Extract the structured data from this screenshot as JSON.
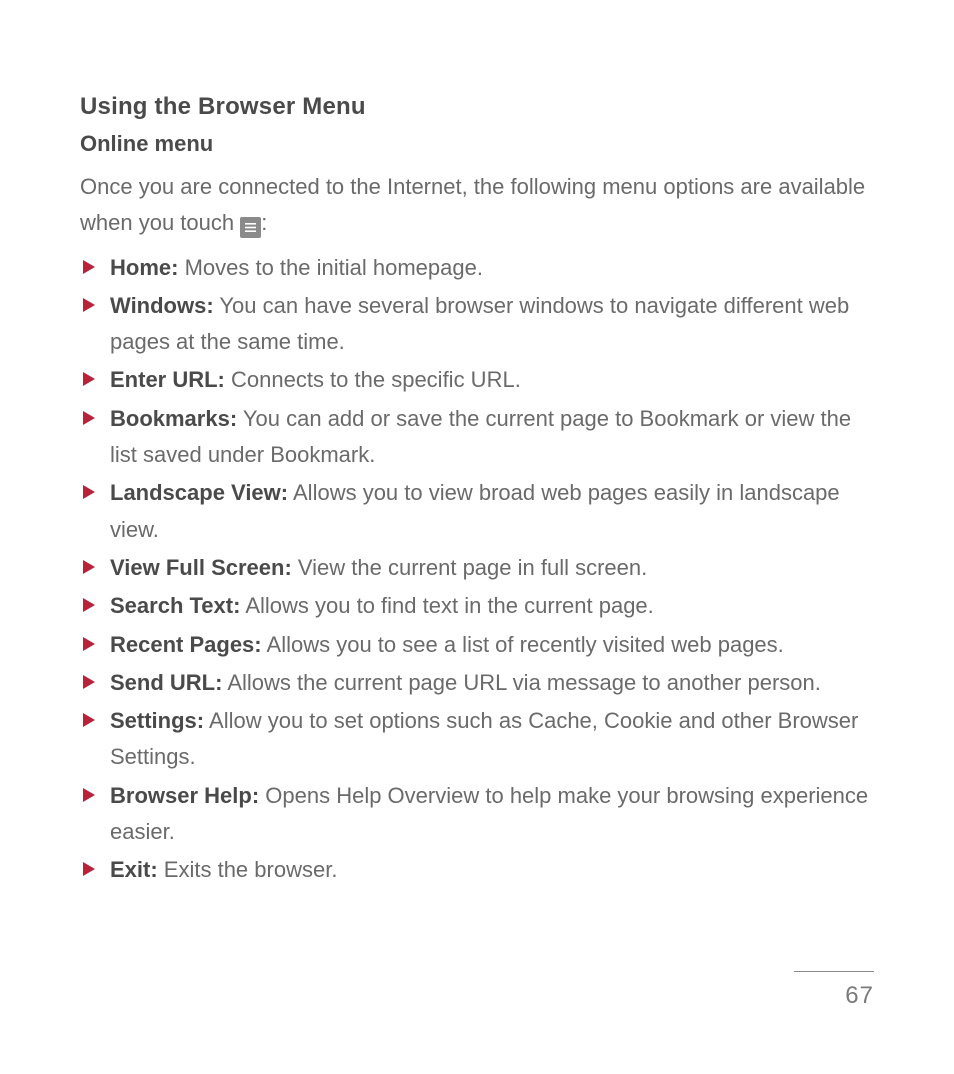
{
  "title": "Using the Browser Menu",
  "subtitle": "Online menu",
  "intro_a": "Once you are connected to the Internet, the following menu options are available when you touch ",
  "intro_b": ":",
  "items": [
    {
      "label": "Home:",
      "desc": " Moves to the initial homepage."
    },
    {
      "label": "Windows:",
      "desc": " You can have several browser windows to navigate different web pages at the same time."
    },
    {
      "label": "Enter URL:",
      "desc": " Connects to the specific URL."
    },
    {
      "label": "Bookmarks:",
      "desc": " You can add or save the current page to Bookmark or view the list saved under Bookmark."
    },
    {
      "label": "Landscape View:",
      "desc": " Allows you to view broad web pages easily in landscape view."
    },
    {
      "label": "View Full Screen:",
      "desc": " View the current page in full screen."
    },
    {
      "label": "Search Text:",
      "desc": " Allows you to find text in the current page."
    },
    {
      "label": "Recent Pages:",
      "desc": " Allows you to see a list of recently visited web pages."
    },
    {
      "label": "Send URL:",
      "desc": " Allows the current page URL via message to another person."
    },
    {
      "label": "Settings:",
      "desc": " Allow you to set options such as Cache, Cookie and other Browser Settings."
    },
    {
      "label": "Browser Help:",
      "desc": " Opens Help Overview to help make your browsing experience easier."
    },
    {
      "label": "Exit:",
      "desc": " Exits the browser."
    }
  ],
  "page_number": "67"
}
